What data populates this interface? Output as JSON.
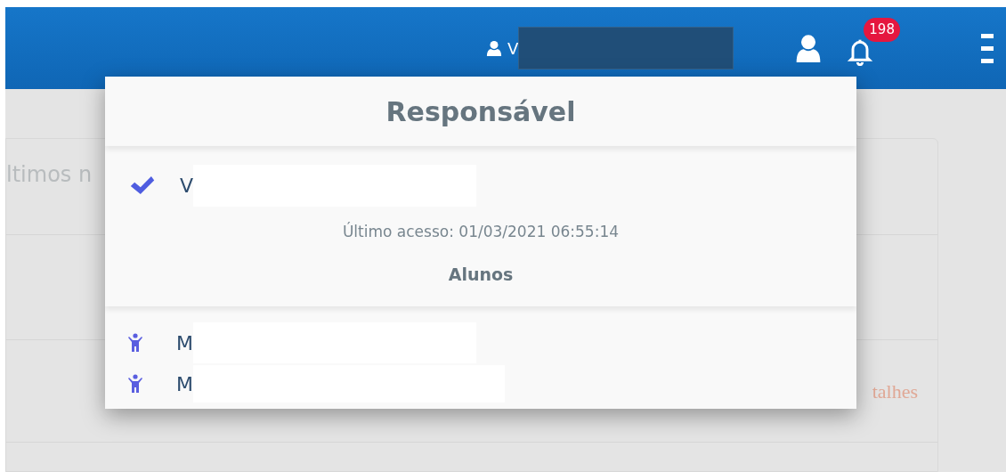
{
  "header": {
    "user_initial": "V",
    "notification_count": "198"
  },
  "background_card": {
    "title_fragment": "ltimos n",
    "link_fragment": "talhes"
  },
  "dropdown": {
    "title": "Responsável",
    "guardians": [
      {
        "name": "V",
        "selected": true
      }
    ],
    "last_access": "Último acesso: 01/03/2021 06:55:14",
    "students_heading": "Alunos",
    "students": [
      {
        "name": "M"
      },
      {
        "name": "M"
      }
    ]
  }
}
